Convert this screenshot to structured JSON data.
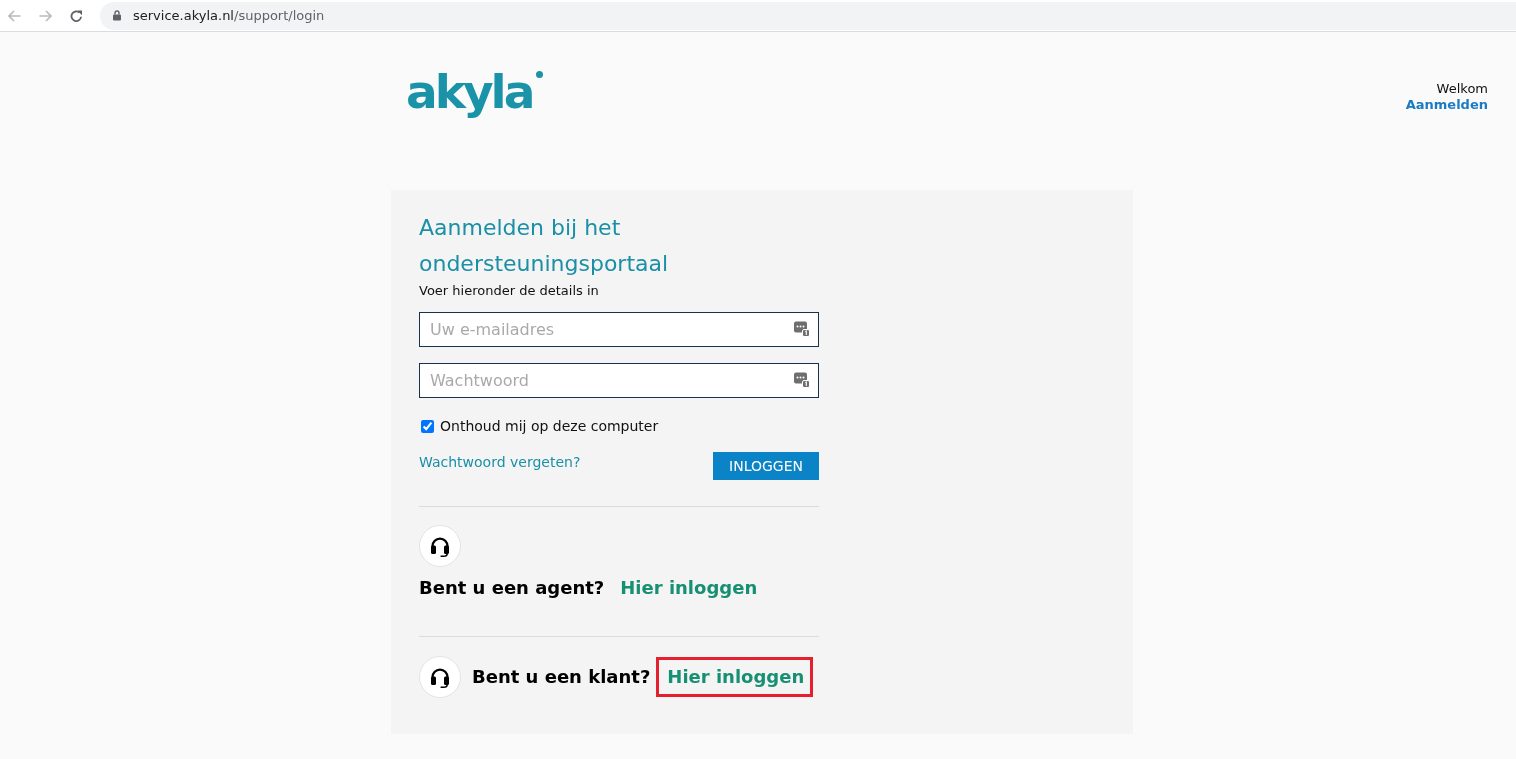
{
  "browser": {
    "url_host": "service.akyla.nl",
    "url_path": "/support/login"
  },
  "header": {
    "logo": "akyla",
    "greeting": "Welkom",
    "sign_in_link": "Aanmelden"
  },
  "login_card": {
    "title": "Aanmelden bij het ondersteuningsportaal",
    "subtitle": "Voer hieronder de details in",
    "fields": [
      {
        "placeholder": "Uw e-mailadres"
      },
      {
        "placeholder": "Wachtwoord"
      }
    ],
    "remember": {
      "label": "Onthoud mij op deze computer",
      "checked": true
    },
    "forgot_link": "Wachtwoord vergeten?",
    "submit_button": "INLOGGEN"
  },
  "help_rows": [
    {
      "kind": "stacked",
      "question": "Bent u een agent?",
      "link": "Hier inloggen",
      "highlighted": false
    },
    {
      "kind": "inline",
      "question": "Bent u een klant?",
      "link": "Hier inloggen",
      "highlighted": true
    }
  ]
}
